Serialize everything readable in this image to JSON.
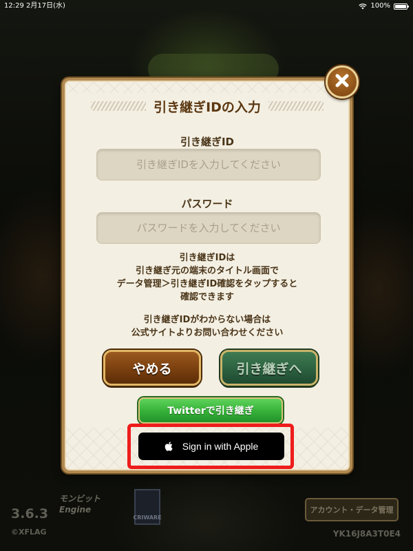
{
  "status_bar": {
    "time": "12:29",
    "date": "2月17日(水)",
    "battery": "100%"
  },
  "dialog": {
    "title": "引き継ぎIDの入力",
    "id_field": {
      "label": "引き継ぎID",
      "placeholder": "引き継ぎIDを入力してください",
      "value": ""
    },
    "password_field": {
      "label": "パスワード",
      "placeholder": "パスワードを入力してください",
      "value": ""
    },
    "help_text_1": "引き継ぎIDは\n引き継ぎ元の端末のタイトル画面で\nデータ管理＞引き継ぎID確認をタップすると\n確認できます",
    "help_text_2": "引き継ぎIDがわからない場合は\n公式サイトよりお問い合わせください",
    "cancel_label": "やめる",
    "continue_label": "引き継ぎへ",
    "twitter_label": "Twitterで引き継ぎ",
    "apple_label": "Sign in with Apple"
  },
  "background": {
    "version": "3.6.3",
    "copyright": "©XFLAG",
    "engine_logo": "モンビットEngine",
    "criware_logo": "CRIWARE",
    "account_button": "アカウント・データ管理",
    "device_code": "YK16J8A3T0E4"
  },
  "colors": {
    "highlight": "#ee1c1c",
    "dialog_bg": "#f3efe3",
    "dialog_frame": "#b28a52",
    "cancel_button": "#7a3f0f",
    "continue_button": "#2c6140",
    "twitter_button": "#38b33a",
    "apple_button": "#000000"
  },
  "icons": {
    "close": "close-icon",
    "apple": "apple-icon",
    "wifi": "wifi-icon",
    "battery": "battery-icon"
  }
}
